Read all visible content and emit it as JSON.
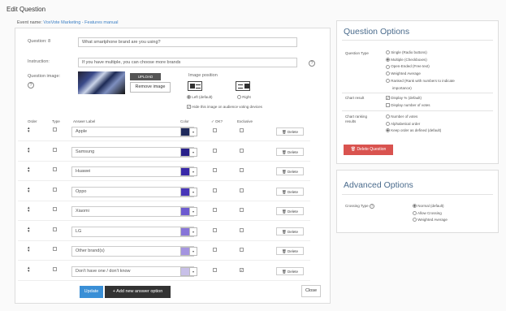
{
  "page": {
    "title": "Edit Question",
    "event_prefix": "Event name:",
    "event_name": "VoxVote Marketing - Features manual"
  },
  "form": {
    "question_label": "Question: 8",
    "question_value": "What smartphone brand are you using?",
    "instruction_label": "Instruction:",
    "instruction_value": "If you have multiple, you can choose more brands",
    "question_image_label": "Question image:",
    "upload_label": "UPLOAD",
    "remove_image_label": "Remove image",
    "image_position_label": "Image position",
    "left_default_label": "Left (default)",
    "right_label": "Right",
    "hide_image_label": "Hide this image on audience voting devices",
    "hide_image_checked": true,
    "image_position_value": "left"
  },
  "table": {
    "headers": {
      "order": "Order",
      "type": "Type",
      "answer_label": "Answer Label",
      "color": "Color",
      "ok": "✓ OK?",
      "exclusive": "Exclusive"
    },
    "delete_label": "🗑 Delete",
    "order_symbol": "▲\n▼",
    "rows": [
      {
        "label": "Apple",
        "color": "#1f2a5c",
        "ok": false,
        "exclusive": false
      },
      {
        "label": "Samsung",
        "color": "#28208a",
        "ok": false,
        "exclusive": false
      },
      {
        "label": "Huawei",
        "color": "#3828a8",
        "ok": false,
        "exclusive": false
      },
      {
        "label": "Oppo",
        "color": "#4836b8",
        "ok": false,
        "exclusive": false
      },
      {
        "label": "Xiaomi",
        "color": "#6c5ad0",
        "ok": false,
        "exclusive": false
      },
      {
        "label": "LG",
        "color": "#8674d8",
        "ok": false,
        "exclusive": false
      },
      {
        "label": "Other brand(s)",
        "color": "#a494e0",
        "ok": false,
        "exclusive": false
      },
      {
        "label": "Don't have one / don't know",
        "color": "#c8c0e8",
        "ok": false,
        "exclusive": true
      }
    ]
  },
  "buttons": {
    "update": "Update",
    "add_answer": "+ Add new answer option",
    "close": "Close"
  },
  "question_options": {
    "title": "Question Options",
    "question_type_label": "Question Type",
    "question_types": [
      {
        "label": "Single (Radio buttons)",
        "selected": false
      },
      {
        "label": "Multiple (Checkboxes)",
        "selected": true
      },
      {
        "label": "Open-Ended (Free text)",
        "selected": false
      },
      {
        "label": "Weighted Average",
        "selected": false
      },
      {
        "label": "Ranked (Rank with numbers to indicate",
        "selected": false
      }
    ],
    "ranked_continuation": "importance)",
    "chart_result_label": "Chart result",
    "chart_results": [
      {
        "label": "Display % (default)",
        "checked": true
      },
      {
        "label": "Display number of votes",
        "checked": false
      }
    ],
    "chart_ranking_label_1": "Chart ranking",
    "chart_ranking_label_2": "results",
    "chart_rankings": [
      {
        "label": "Number of votes",
        "selected": false
      },
      {
        "label": "Alphabetical order",
        "selected": false
      },
      {
        "label": "Keep order as defined (default)",
        "selected": true
      }
    ],
    "delete_question_label": "🗑 Delete Question",
    "accent_color": "#d9534f"
  },
  "advanced_options": {
    "title": "Advanced Options",
    "crossing_type_label": "Crossing Type",
    "crossing_types": [
      {
        "label": "Normal (default)",
        "selected": true
      },
      {
        "label": "Allow Crossing",
        "selected": false
      },
      {
        "label": "Weighted Average",
        "selected": false
      }
    ]
  },
  "colors": {
    "primary_button": "#3a8fd6",
    "dark_button": "#333333",
    "link": "#3b7fc4",
    "panel_title": "#4a6b8c"
  }
}
